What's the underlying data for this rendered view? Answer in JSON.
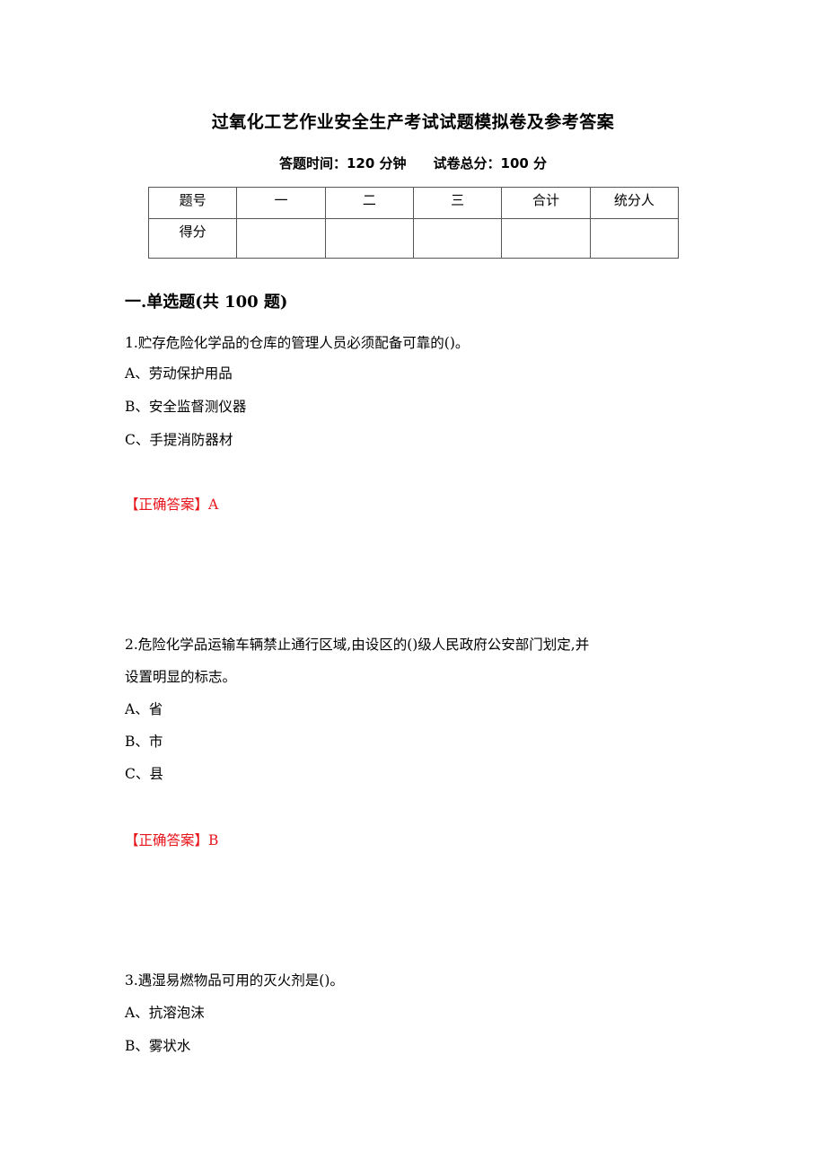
{
  "document": {
    "title": "过氧化工艺作业安全生产考试试题模拟卷及参考答案",
    "subtitle": {
      "time": "答题时间：120 分钟",
      "total": "试卷总分：100 分"
    },
    "score_table": {
      "header": [
        "题号",
        "一",
        "二",
        "三",
        "合计",
        "统分人"
      ],
      "row": [
        "得分",
        "",
        "",
        "",
        "",
        ""
      ]
    },
    "section_title": "一.单选题(共 100 题)",
    "questions": [
      {
        "text_lines": [
          "1.贮存危险化学品的仓库的管理人员必须配备可靠的()。"
        ],
        "options": [
          "A、劳动保护用品",
          "B、安全监督测仪器",
          "C、手提消防器材"
        ],
        "answer": "【正确答案】A"
      },
      {
        "text_lines": [
          "2.危险化学品运输车辆禁止通行区域,由设区的()级人民政府公安部门划定,并",
          "设置明显的标志。"
        ],
        "options": [
          "A、省",
          "B、市",
          "C、县"
        ],
        "answer": "【正确答案】B"
      },
      {
        "text_lines": [
          "3.遇湿易燃物品可用的灭火剂是()。"
        ],
        "options": [
          "A、抗溶泡沫",
          "B、雾状水"
        ]
      }
    ],
    "colors": {
      "answer": "#e8141b",
      "text": "#000000"
    }
  }
}
